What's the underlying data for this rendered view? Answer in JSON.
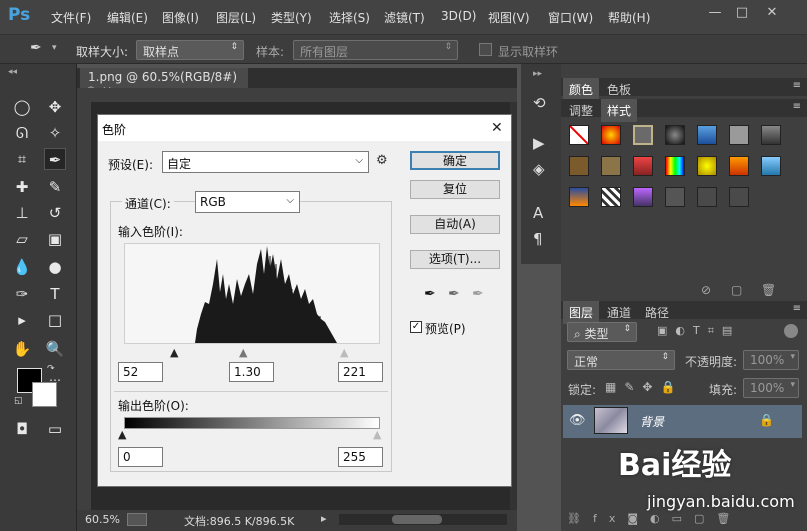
{
  "app": {
    "logo": "Ps"
  },
  "menus": [
    "文件(F)",
    "编辑(E)",
    "图像(I)",
    "图层(L)",
    "类型(Y)",
    "选择(S)",
    "滤镜(T)",
    "3D(D)",
    "视图(V)",
    "窗口(W)",
    "帮助(H)"
  ],
  "options": {
    "sample_size_label": "取样大小:",
    "sample_size_value": "取样点",
    "sample_label": "样本:",
    "sample_value": "所有图层",
    "show_ring_label": "显示取样环"
  },
  "document": {
    "tab_title": "1.png @ 60.5%(RGB/8#) *",
    "zoom": "60.5%",
    "doc_info": "文档:896.5 K/896.5K"
  },
  "dialog": {
    "title": "色阶",
    "preset_label": "预设(E):",
    "preset_value": "自定",
    "channel_label": "通道(C):",
    "channel_value": "RGB",
    "input_label": "输入色阶(I):",
    "input_black": "52",
    "input_gamma": "1.30",
    "input_white": "221",
    "output_label": "输出色阶(O):",
    "output_black": "0",
    "output_white": "255",
    "buttons": {
      "ok": "确定",
      "reset": "复位",
      "auto": "自动(A)",
      "options": "选项(T)..."
    },
    "preview_label": "预览(P)",
    "preview_checked": true
  },
  "panels": {
    "color_tabs": [
      "颜色",
      "色板"
    ],
    "style_tabs": [
      "调整",
      "样式"
    ],
    "layer_tabs": [
      "图层",
      "通道",
      "路径"
    ],
    "kind_label": "类型",
    "blend_mode": "正常",
    "opacity_label": "不透明度:",
    "opacity_value": "100%",
    "lock_label": "锁定:",
    "fill_label": "填充:",
    "fill_value": "100%",
    "layer_name": "背景"
  },
  "watermark": {
    "brand": "Bai经验",
    "url": "jingyan.baidu.com"
  }
}
